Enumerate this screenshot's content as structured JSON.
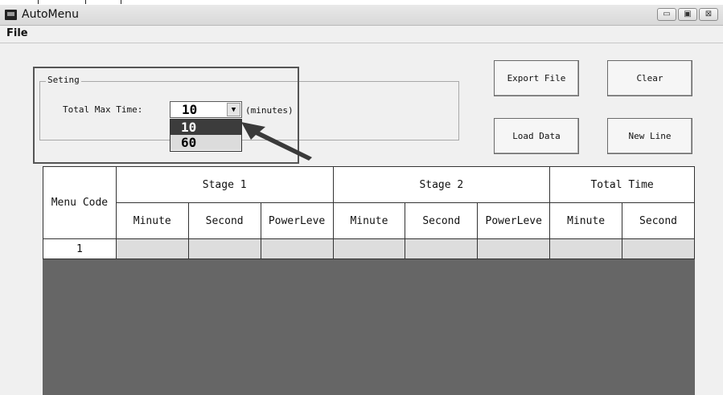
{
  "window": {
    "title": "AutoMenu",
    "controls": {
      "minimize": "▭",
      "maximize": "▣",
      "close": "⊠"
    }
  },
  "menubar": {
    "file_label": "File"
  },
  "toolbar": {
    "export_label": "Export File",
    "clear_label": "Clear",
    "load_label": "Load Data",
    "newline_label": "New Line"
  },
  "setting": {
    "group_label": "Seting",
    "total_label": "Total Max Time:",
    "combo_value": "10",
    "units_label": "(minutes)",
    "options": [
      "10",
      "60"
    ],
    "selected_option": "10"
  },
  "grid": {
    "menu_code_label": "Menu Code",
    "groups": [
      "Stage 1",
      "Stage 2",
      "Total Time"
    ],
    "subheaders": [
      "Minute",
      "Second",
      "PowerLeve",
      "Minute",
      "Second",
      "PowerLeve",
      "Minute",
      "Second"
    ],
    "rows": [
      {
        "menu_code": "1",
        "cells": [
          "",
          "",
          "",
          "",
          "",
          "",
          "",
          ""
        ]
      }
    ]
  },
  "colors": {
    "grid_empty_area": "#666666",
    "row_cell": "#dddddd",
    "selected_option": "#3c3c3c"
  }
}
